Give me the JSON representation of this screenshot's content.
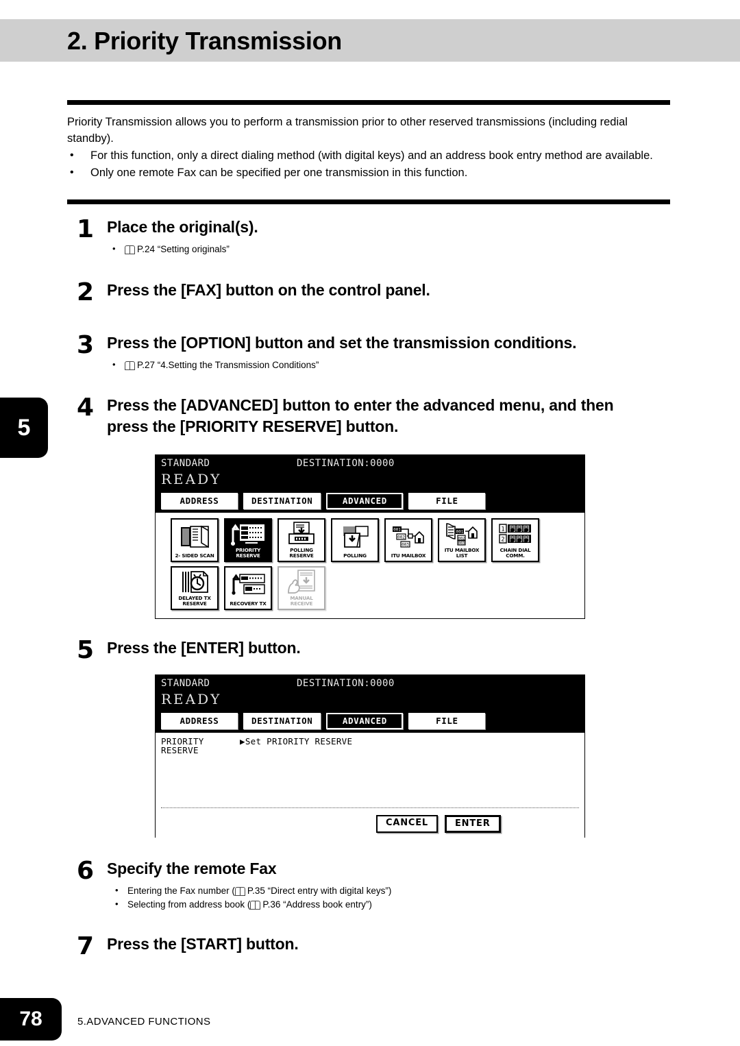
{
  "page": {
    "title": "2. Priority Transmission",
    "number": "78",
    "footer_section": "5.ADVANCED FUNCTIONS",
    "chapter_tab": "5"
  },
  "intro": {
    "paragraph": "Priority Transmission allows you to perform a transmission prior to other reserved transmissions (including redial standby).",
    "bullets": [
      "For this function, only a direct dialing method (with digital keys) and an address book entry method are available.",
      "Only one remote Fax can be specified per one transmission in this function."
    ],
    "bullet_mark": "•"
  },
  "steps": [
    {
      "num": "1",
      "heading": "Place the original(s).",
      "refs": [
        {
          "dot": "•",
          "text": "P.24 “Setting originals”"
        }
      ]
    },
    {
      "num": "2",
      "heading": "Press the [FAX] button on the control panel.",
      "refs": []
    },
    {
      "num": "3",
      "heading": "Press the [OPTION] button and set the transmission conditions.",
      "refs": [
        {
          "dot": "•",
          "text": "P.27 “4.Setting the Transmission Conditions”"
        }
      ]
    },
    {
      "num": "4",
      "heading_line1": "Press the [ADVANCED] button to enter the advanced menu, and then",
      "heading_line2": "press the [PRIORITY RESERVE] button.",
      "refs": []
    },
    {
      "num": "5",
      "heading": "Press the [ENTER] button.",
      "refs": []
    },
    {
      "num": "6",
      "heading": "Specify the remote Fax",
      "refs": [
        {
          "dot": "•",
          "text_pre": "Entering the Fax number (",
          "text": "P.35 “Direct entry with digital keys”)"
        },
        {
          "dot": "•",
          "text_pre": "Selecting from address book (",
          "text": "P.36 “Address book entry”)"
        }
      ]
    },
    {
      "num": "7",
      "heading": "Press the [START] button.",
      "refs": []
    }
  ],
  "lcd_advanced": {
    "status_mode": "STANDARD",
    "destination": "DESTINATION:0000",
    "state": "READY",
    "tabs": [
      {
        "label": "ADDRESS",
        "active": false
      },
      {
        "label": "DESTINATION",
        "active": false
      },
      {
        "label": "ADVANCED",
        "active": true
      },
      {
        "label": "FILE",
        "active": false
      }
    ],
    "keys_row1": [
      {
        "label": "2- SIDED SCAN",
        "icon": "two-sided-scan-icon",
        "selected": false,
        "disabled": false
      },
      {
        "label": "PRIORITY RESERVE",
        "icon": "priority-reserve-icon",
        "selected": true,
        "disabled": false
      },
      {
        "label": "POLLING RESERVE",
        "icon": "polling-reserve-icon",
        "selected": false,
        "disabled": false
      },
      {
        "label": "POLLING",
        "icon": "polling-icon",
        "selected": false,
        "disabled": false
      },
      {
        "label": "ITU MAILBOX",
        "icon": "itu-mailbox-icon",
        "selected": false,
        "disabled": false
      },
      {
        "label": "ITU MAILBOX LIST",
        "icon": "itu-mailbox-list-icon",
        "selected": false,
        "disabled": false
      },
      {
        "label": "CHAIN DIAL COMM.",
        "icon": "chain-dial-comm-icon",
        "selected": false,
        "disabled": false
      }
    ],
    "keys_row2": [
      {
        "label": "DELAYED TX RESERVE",
        "icon": "delayed-tx-reserve-icon",
        "selected": false,
        "disabled": false
      },
      {
        "label": "RECOVERY TX",
        "icon": "recovery-tx-icon",
        "selected": false,
        "disabled": false
      },
      {
        "label": "MANUAL RECEIVE",
        "icon": "manual-receive-icon",
        "selected": false,
        "disabled": true
      }
    ]
  },
  "lcd_enter": {
    "status_mode": "STANDARD",
    "destination": "DESTINATION:0000",
    "state": "READY",
    "tabs": [
      {
        "label": "ADDRESS",
        "active": false
      },
      {
        "label": "DESTINATION",
        "active": false
      },
      {
        "label": "ADVANCED",
        "active": true
      },
      {
        "label": "FILE",
        "active": false
      }
    ],
    "setting_label_line1": "PRIORITY",
    "setting_label_line2": "RESERVE",
    "setting_value": "▶Set PRIORITY RESERVE",
    "buttons": [
      {
        "label": "CANCEL",
        "emphasis": false
      },
      {
        "label": "ENTER",
        "emphasis": true
      }
    ]
  },
  "colors": {
    "header_band": "#cfcfcf",
    "ink": "#000000",
    "lcd_bg": "#ffffff",
    "lcd_top_bg": "#000000"
  }
}
